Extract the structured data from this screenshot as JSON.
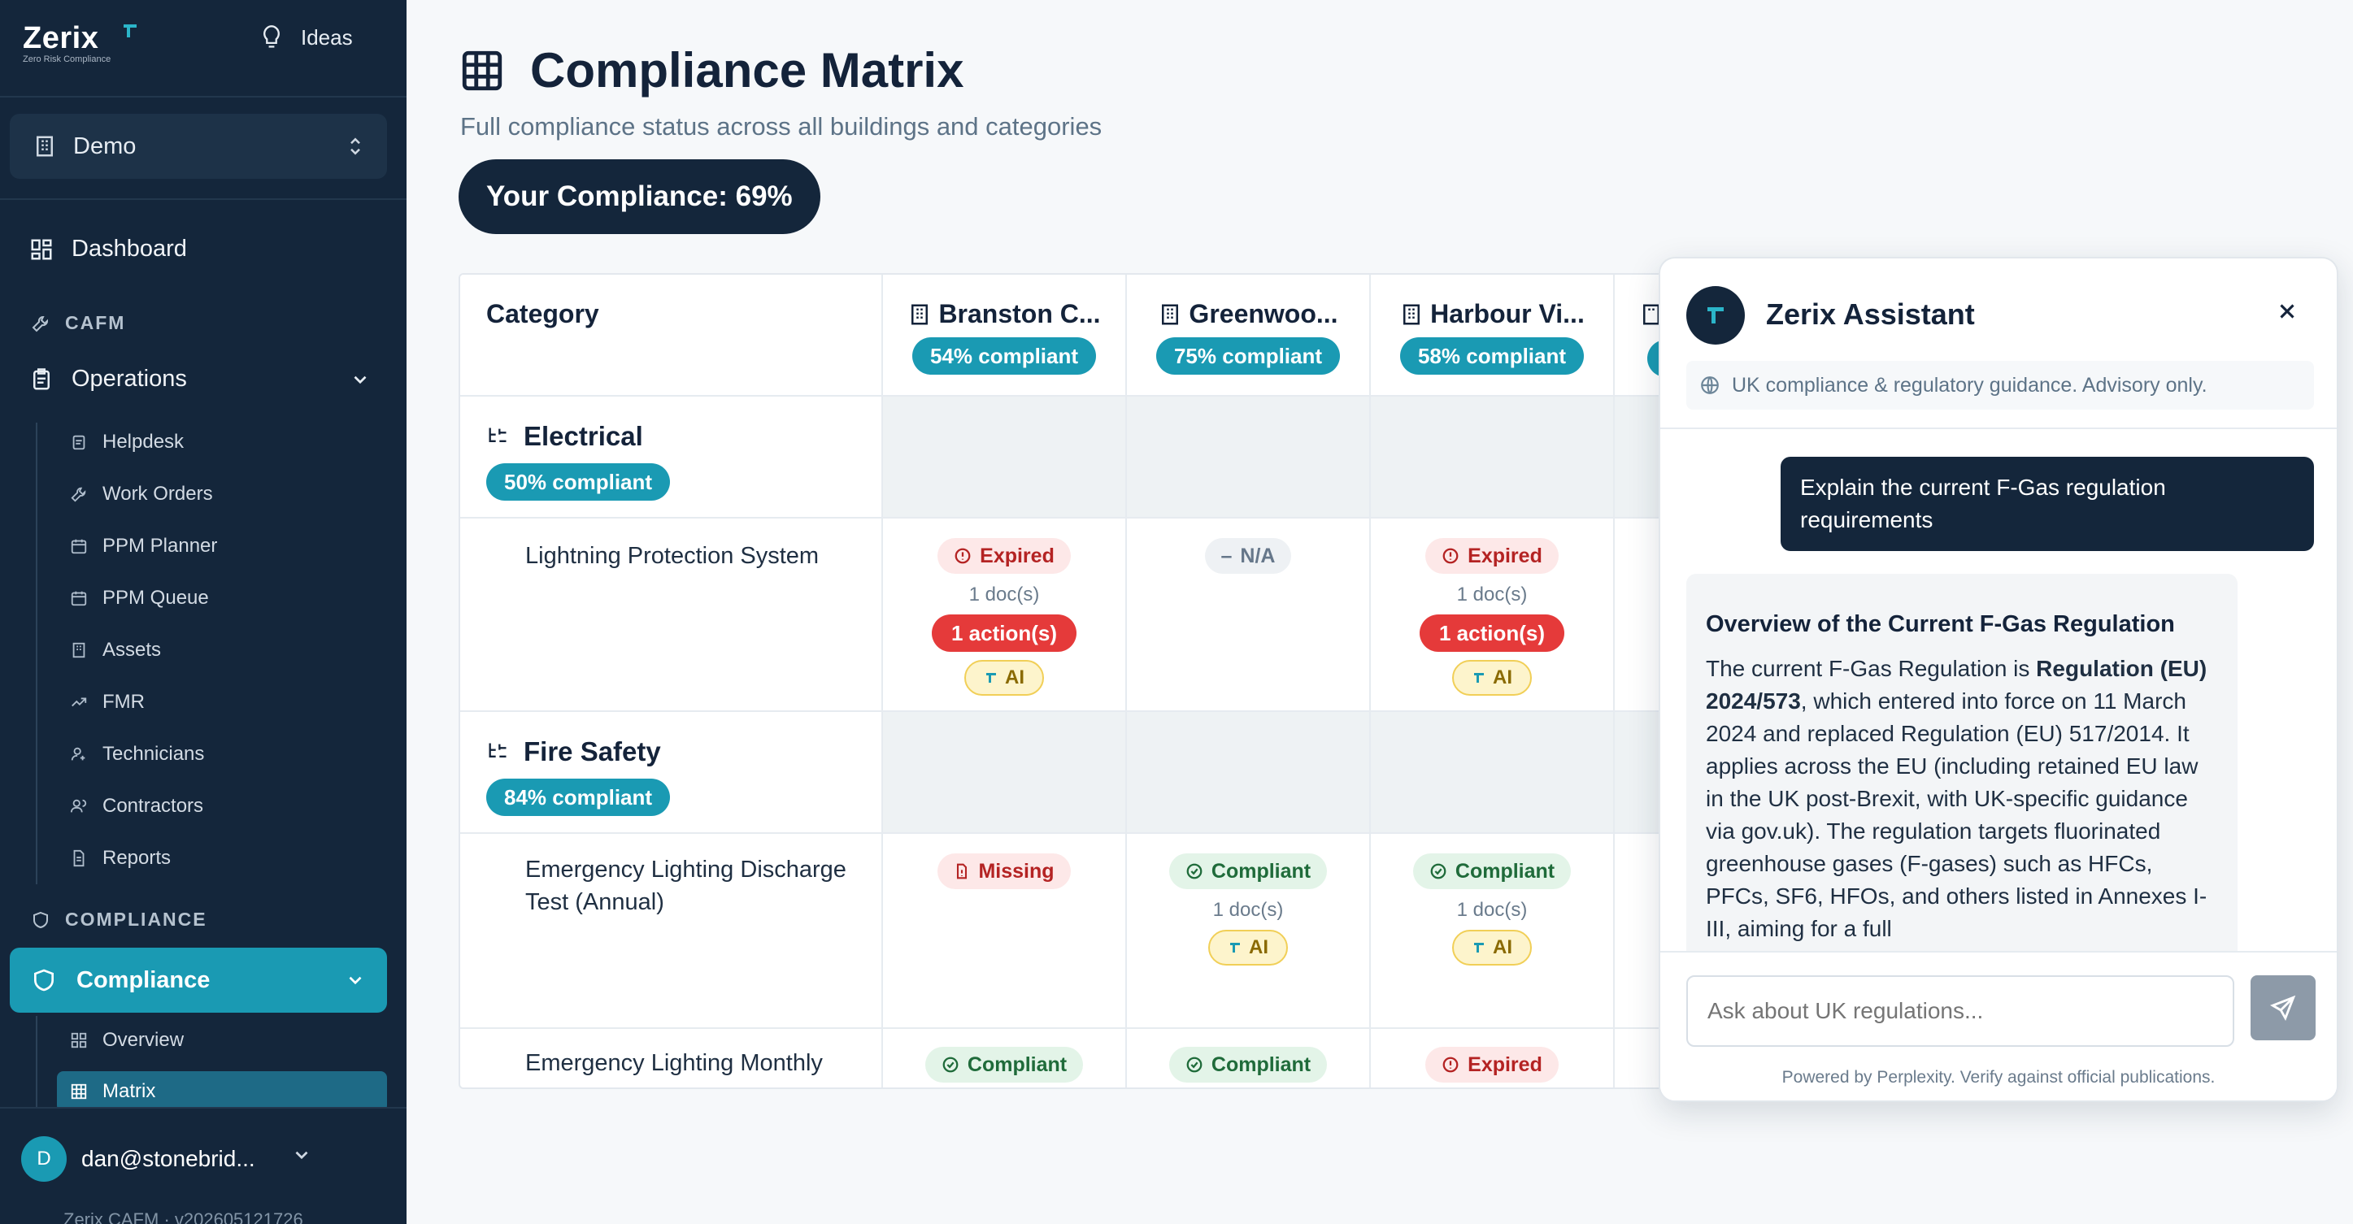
{
  "sidebar": {
    "logo": {
      "word": "Zerix",
      "sub": "Zero Risk Compliance"
    },
    "ideas_label": "Ideas",
    "org_name": "Demo",
    "dashboard_label": "Dashboard",
    "cafm_section": "CAFM",
    "operations_label": "Operations",
    "operations_items": [
      "Helpdesk",
      "Work Orders",
      "PPM Planner",
      "PPM Queue",
      "Assets",
      "FMR",
      "Technicians",
      "Contractors",
      "Reports"
    ],
    "compliance_section": "COMPLIANCE",
    "compliance_label": "Compliance",
    "compliance_items": [
      "Overview",
      "Matrix"
    ],
    "user_initial": "D",
    "user_email": "dan@stonebrid...",
    "version": "Zerix CAFM · v202605121726"
  },
  "page": {
    "title": "Compliance Matrix",
    "subtitle": "Full compliance status across all buildings and categories",
    "score": "Your Compliance: 69%"
  },
  "matrix": {
    "category_header": "Category",
    "buildings": [
      {
        "name": "Branston C...",
        "compliance": "54% compliant"
      },
      {
        "name": "Greenwoo...",
        "compliance": "75% compliant"
      },
      {
        "name": "Harbour Vi...",
        "compliance": "58% compliant"
      }
    ],
    "categories": [
      {
        "name": "Electrical",
        "compliance": "50% compliant"
      },
      {
        "name": "Fire Safety",
        "compliance": "84% compliant"
      }
    ],
    "rows": [
      {
        "label": "Lightning Protection System",
        "cells": [
          {
            "status": "Expired",
            "docs": "1 doc(s)",
            "action": "1 action(s)",
            "ai": "AI"
          },
          {
            "status": "N/A"
          },
          {
            "status": "Expired",
            "docs": "1 doc(s)",
            "action": "1 action(s)",
            "ai": "AI"
          }
        ]
      },
      {
        "label": "Emergency Lighting Discharge Test (Annual)",
        "cells": [
          {
            "status": "Missing"
          },
          {
            "status": "Compliant",
            "docs": "1 doc(s)",
            "ai": "AI"
          },
          {
            "status": "Compliant",
            "docs": "1 doc(s)",
            "ai": "AI"
          }
        ]
      },
      {
        "label": "Emergency Lighting Monthly",
        "cells": [
          {
            "status": "Compliant"
          },
          {
            "status": "Compliant"
          },
          {
            "status": "Expired"
          }
        ]
      }
    ]
  },
  "assistant": {
    "title": "Zerix Assistant",
    "note": "UK compliance & regulatory guidance. Advisory only.",
    "user_message": "Explain the current F-Gas regulation requirements",
    "bot_heading": "Overview of the Current F-Gas Regulation",
    "bot_text_1": "The current F-Gas Regulation is ",
    "bot_text_bold": "Regulation (EU) 2024/573",
    "bot_text_2": ", which entered into force on 11 March 2024 and replaced Regulation (EU) 517/2014. It applies across the EU (including retained EU law in the UK post-Brexit, with UK-specific guidance via gov.uk). The regulation targets fluorinated greenhouse gases (F-gases) such as HFCs, PFCs, SF6, HFOs, and others listed in Annexes I-III, aiming for a full",
    "input_placeholder": "Ask about UK regulations...",
    "powered_by": "Powered by Perplexity. Verify against official publications."
  },
  "colors": {
    "sidebar_bg": "#14263b",
    "accent_teal": "#1a9ab3",
    "expired_red": "#b42323",
    "compliant_green": "#1f6b3a",
    "action_red": "#e53a3a",
    "ai_yellow": "#fdf4cc"
  },
  "icons": {
    "logo": "zerix-mark-icon",
    "ideas": "lightbulb-icon",
    "org": "building-icon",
    "dashboard": "grid-icon",
    "cafm": "wrench-icon",
    "operations": "clipboard-icon",
    "compliance": "shield-icon",
    "matrix": "table-icon"
  }
}
